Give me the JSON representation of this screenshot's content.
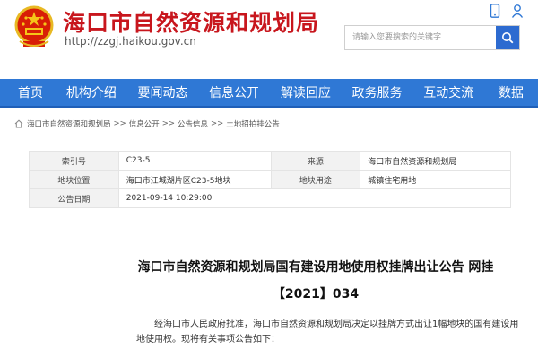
{
  "header": {
    "site_title": "海口市自然资源和规划局",
    "site_url": "http://zzgj.haikou.gov.cn",
    "search_placeholder": "请输入您要搜索的关键字"
  },
  "nav": {
    "items": [
      "首页",
      "机构介绍",
      "要闻动态",
      "信息公开",
      "解读回应",
      "政务服务",
      "互动交流",
      "数据"
    ]
  },
  "breadcrumb": {
    "items": [
      "海口市自然资源和规划局",
      "信息公开",
      "公告信息",
      "土地招拍挂公告"
    ],
    "separator": ">>"
  },
  "info_table": {
    "rows": [
      {
        "label1": "索引号",
        "value1": "C23-5",
        "label2": "来源",
        "value2": "海口市自然资源和规划局"
      },
      {
        "label1": "地块位置",
        "value1": "海口市江城湖片区C23-5地块",
        "label2": "地块用途",
        "value2": "城镇住宅用地"
      },
      {
        "label1": "公告日期",
        "value1": "2021-09-14 10:29:00"
      }
    ]
  },
  "article": {
    "title": "海口市自然资源和规划局国有建设用地使用权挂牌出让公告 网挂【2021】034",
    "body": "经海口市人民政府批准，海口市自然资源和规划局决定以挂牌方式出让1幅地块的国有建设用地使用权。现将有关事项公告如下："
  },
  "colors": {
    "brand_red": "#c8161d",
    "nav_blue": "#2f78d5"
  }
}
